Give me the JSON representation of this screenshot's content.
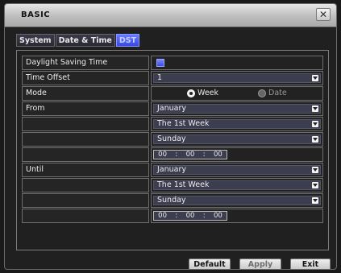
{
  "window": {
    "title": "BASIC",
    "close_glyph": "✕"
  },
  "tabs": [
    {
      "label": "System",
      "active": false
    },
    {
      "label": "Date & Time",
      "active": false
    },
    {
      "label": "DST",
      "active": true
    }
  ],
  "dst": {
    "daylight_saving_label": "Daylight Saving Time",
    "daylight_saving_checked": true,
    "time_offset_label": "Time Offset",
    "time_offset_value": "1",
    "mode_label": "Mode",
    "mode_options": [
      {
        "label": "Week",
        "selected": true
      },
      {
        "label": "Date",
        "selected": false
      }
    ],
    "from_label": "From",
    "from": {
      "month": "January",
      "week": "The 1st Week",
      "day": "Sunday",
      "time": [
        "00",
        "00",
        "00"
      ]
    },
    "until_label": "Until",
    "until": {
      "month": "January",
      "week": "The 1st Week",
      "day": "Sunday",
      "time": [
        "00",
        "00",
        "00"
      ]
    }
  },
  "buttons": {
    "default": "Default",
    "apply": "Apply",
    "exit": "Exit"
  },
  "colors": {
    "accent": "#4a5af0",
    "titlebar": "#bdbdbd",
    "background": "#202020"
  },
  "icons": {
    "close": "close-icon",
    "dropdown": "chevron-down-icon",
    "checkbox": "checkbox-checked-icon"
  }
}
